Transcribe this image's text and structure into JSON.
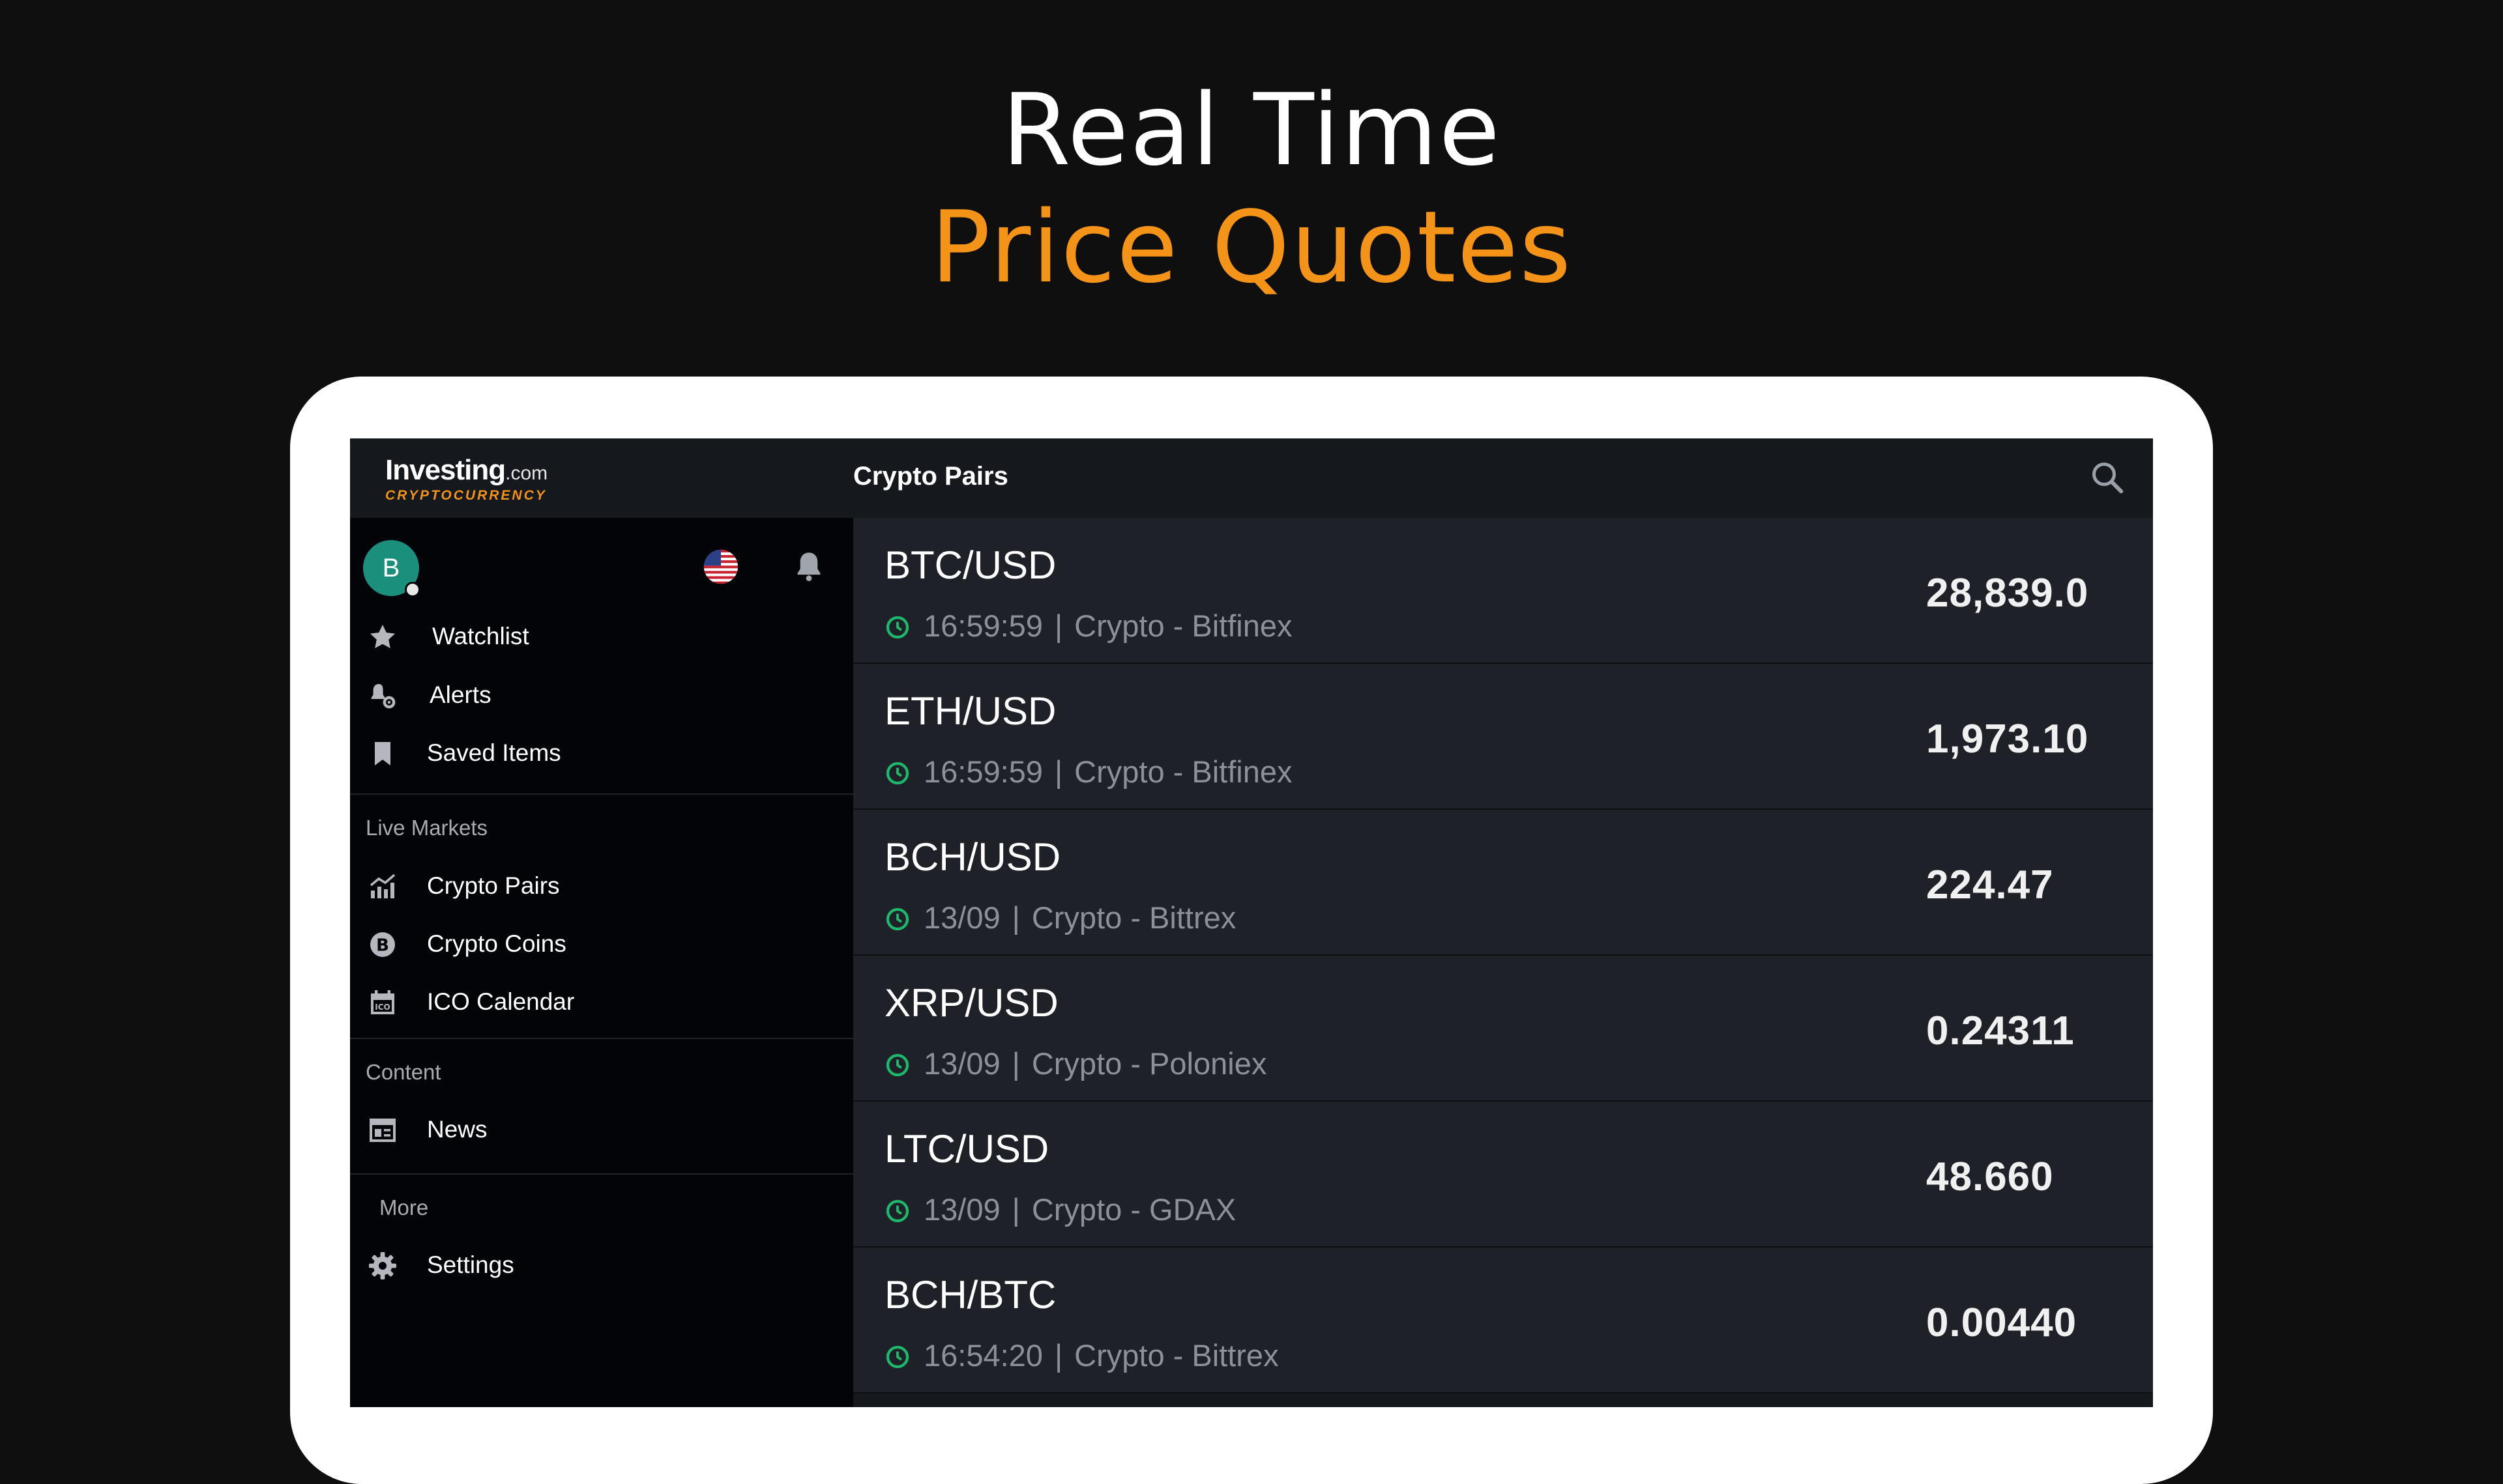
{
  "headline": {
    "line1": "Real Time",
    "line2": "Price Quotes"
  },
  "topbar": {
    "logo_main": "Investing",
    "logo_suffix": ".com",
    "logo_sub": "CRYPTOCURRENCY",
    "title": "Crypto Pairs",
    "search_icon": "search-icon"
  },
  "sidebar": {
    "avatar_initial": "B",
    "items": [
      {
        "label": "Watchlist",
        "icon": "star-icon"
      },
      {
        "label": "Alerts",
        "icon": "bell-gear-icon"
      },
      {
        "label": "Saved Items",
        "icon": "bookmark-icon"
      }
    ],
    "sections": [
      {
        "label": "Live Markets",
        "items": [
          {
            "label": "Crypto Pairs",
            "icon": "chart-icon"
          },
          {
            "label": "Crypto Coins",
            "icon": "bitcoin-icon"
          },
          {
            "label": "ICO Calendar",
            "icon": "calendar-icon"
          }
        ]
      },
      {
        "label": "Content",
        "items": [
          {
            "label": "News",
            "icon": "news-icon"
          }
        ]
      },
      {
        "label": "More",
        "items": [
          {
            "label": "Settings",
            "icon": "gear-icon"
          }
        ]
      }
    ]
  },
  "quotes": [
    {
      "pair": "BTC/USD",
      "time": "16:59:59",
      "source": "Crypto - Bitfinex",
      "price": "28,839.0"
    },
    {
      "pair": "ETH/USD",
      "time": "16:59:59",
      "source": "Crypto - Bitfinex",
      "price": "1,973.10"
    },
    {
      "pair": "BCH/USD",
      "time": "13/09",
      "source": "Crypto - Bittrex",
      "price": "224.47"
    },
    {
      "pair": "XRP/USD",
      "time": "13/09",
      "source": "Crypto - Poloniex",
      "price": "0.24311"
    },
    {
      "pair": "LTC/USD",
      "time": "13/09",
      "source": "Crypto - GDAX",
      "price": "48.660"
    },
    {
      "pair": "BCH/BTC",
      "time": "16:54:20",
      "source": "Crypto - Bittrex",
      "price": "0.00440"
    }
  ],
  "meta_separator": "|",
  "colors": {
    "accent": "#f39419",
    "clock": "#1db86b",
    "avatar": "#1a8f7c"
  }
}
